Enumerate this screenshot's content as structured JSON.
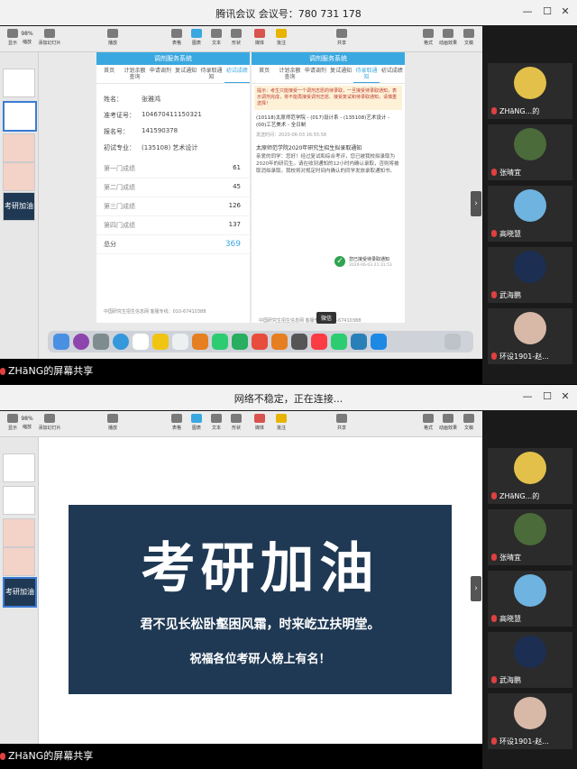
{
  "top": {
    "title": "腾讯会议  会议号：780 731 178",
    "controls": [
      "—",
      "☐",
      "✕"
    ],
    "zoom": "98%",
    "toolbar": [
      "显示",
      "缩放",
      "添加幻灯片",
      "播放",
      "表格",
      "图表",
      "文本",
      "形状",
      "媒体",
      "批注",
      "共享",
      "格式",
      "动画效果",
      "文稿"
    ],
    "footer_user": "ZHāNG",
    "footer_text": "的屏幕共享",
    "thumb_label": "考研加油",
    "left_phone": {
      "header": "调剂服务系统",
      "tabs": [
        "首页",
        "计划余额查询",
        "申请调剂",
        "复试通知",
        "待录取通知",
        "初试成绩"
      ],
      "name_label": "姓名：",
      "name_value": "张雅鸿",
      "ticket_label": "准考证号：",
      "ticket_value": "104670411150321",
      "reg_label": "报名号：",
      "reg_value": "141590378",
      "major_label": "初试专业：",
      "major_value": "(135108) 艺术设计",
      "scores": [
        {
          "label": "第一门成绩",
          "value": "61"
        },
        {
          "label": "第二门成绩",
          "value": "45"
        },
        {
          "label": "第三门成绩",
          "value": "126"
        },
        {
          "label": "第四门成绩",
          "value": "137"
        }
      ],
      "total_label": "总分",
      "total_value": "369",
      "foot": "中国研究生招生信息网    客服专线：010-67410388"
    },
    "right_phone": {
      "header": "调剂服务系统",
      "tabs": [
        "首页",
        "计划余额查询",
        "申请调剂",
        "复试通知",
        "待录取通知",
        "初试成绩"
      ],
      "notice": "提示：考生只能接受一个调剂志愿的待录取，一旦接受待录取通知，表示调剂完成，将不能再接受调剂志愿、接受复试和待录取通知，请慎重选择！",
      "item1": "(10118)太原师范学院 - (017)设计系 - (135108)艺术设计 - (00)工艺美术 - 全日制",
      "item1_time": "发送时间：2020-06-03 16:55:58",
      "item2_title": "太原师范学院2020年研究生招生拟录取通知",
      "item2_body": "亲爱的同学：您好！经过复试和综合考评，您已被我校拟录取为2020年的研究生。请在收到通知的12小时内确认录取，否则将被取消拟录取。我校将对规定时间内确认的同学发放录取通知书。",
      "accepted": "您已接受待录取通知",
      "accepted_time": "2020-06-03 21:31:53",
      "tooltip": "微信",
      "foot": "中国研究生招生信息网    客服专线：010-67410388"
    },
    "participants": [
      {
        "name": "ZHāNG...的"
      },
      {
        "name": "张晴宜"
      },
      {
        "name": "高晓慧"
      },
      {
        "name": "武海鹏"
      },
      {
        "name": "环设1901-赵..."
      }
    ]
  },
  "bottom": {
    "title": "网络不稳定，正在连接...",
    "controls": [
      "—",
      "☐",
      "✕"
    ],
    "zoom": "98%",
    "toolbar": [
      "显示",
      "缩放",
      "添加幻灯片",
      "播放",
      "表格",
      "图表",
      "文本",
      "形状",
      "媒体",
      "批注",
      "共享",
      "格式",
      "动画效果",
      "文稿"
    ],
    "footer_user": "ZHāNG",
    "footer_text": "的屏幕共享",
    "thumb_label": "考研加油",
    "slide": {
      "headline": "考研加油",
      "line1": "君不见长松卧壑困风霜，时来屹立扶明堂。",
      "line2": "祝福各位考研人榜上有名！"
    },
    "participants": [
      {
        "name": "ZHāNG...的"
      },
      {
        "name": "张晴宜"
      },
      {
        "name": "高晓慧"
      },
      {
        "name": "武海鹏"
      },
      {
        "name": "环设1901-赵..."
      }
    ]
  },
  "colors": {
    "accent": "#3aa8e0",
    "slide_bg": "#1f3954",
    "mic": "#e04040"
  }
}
